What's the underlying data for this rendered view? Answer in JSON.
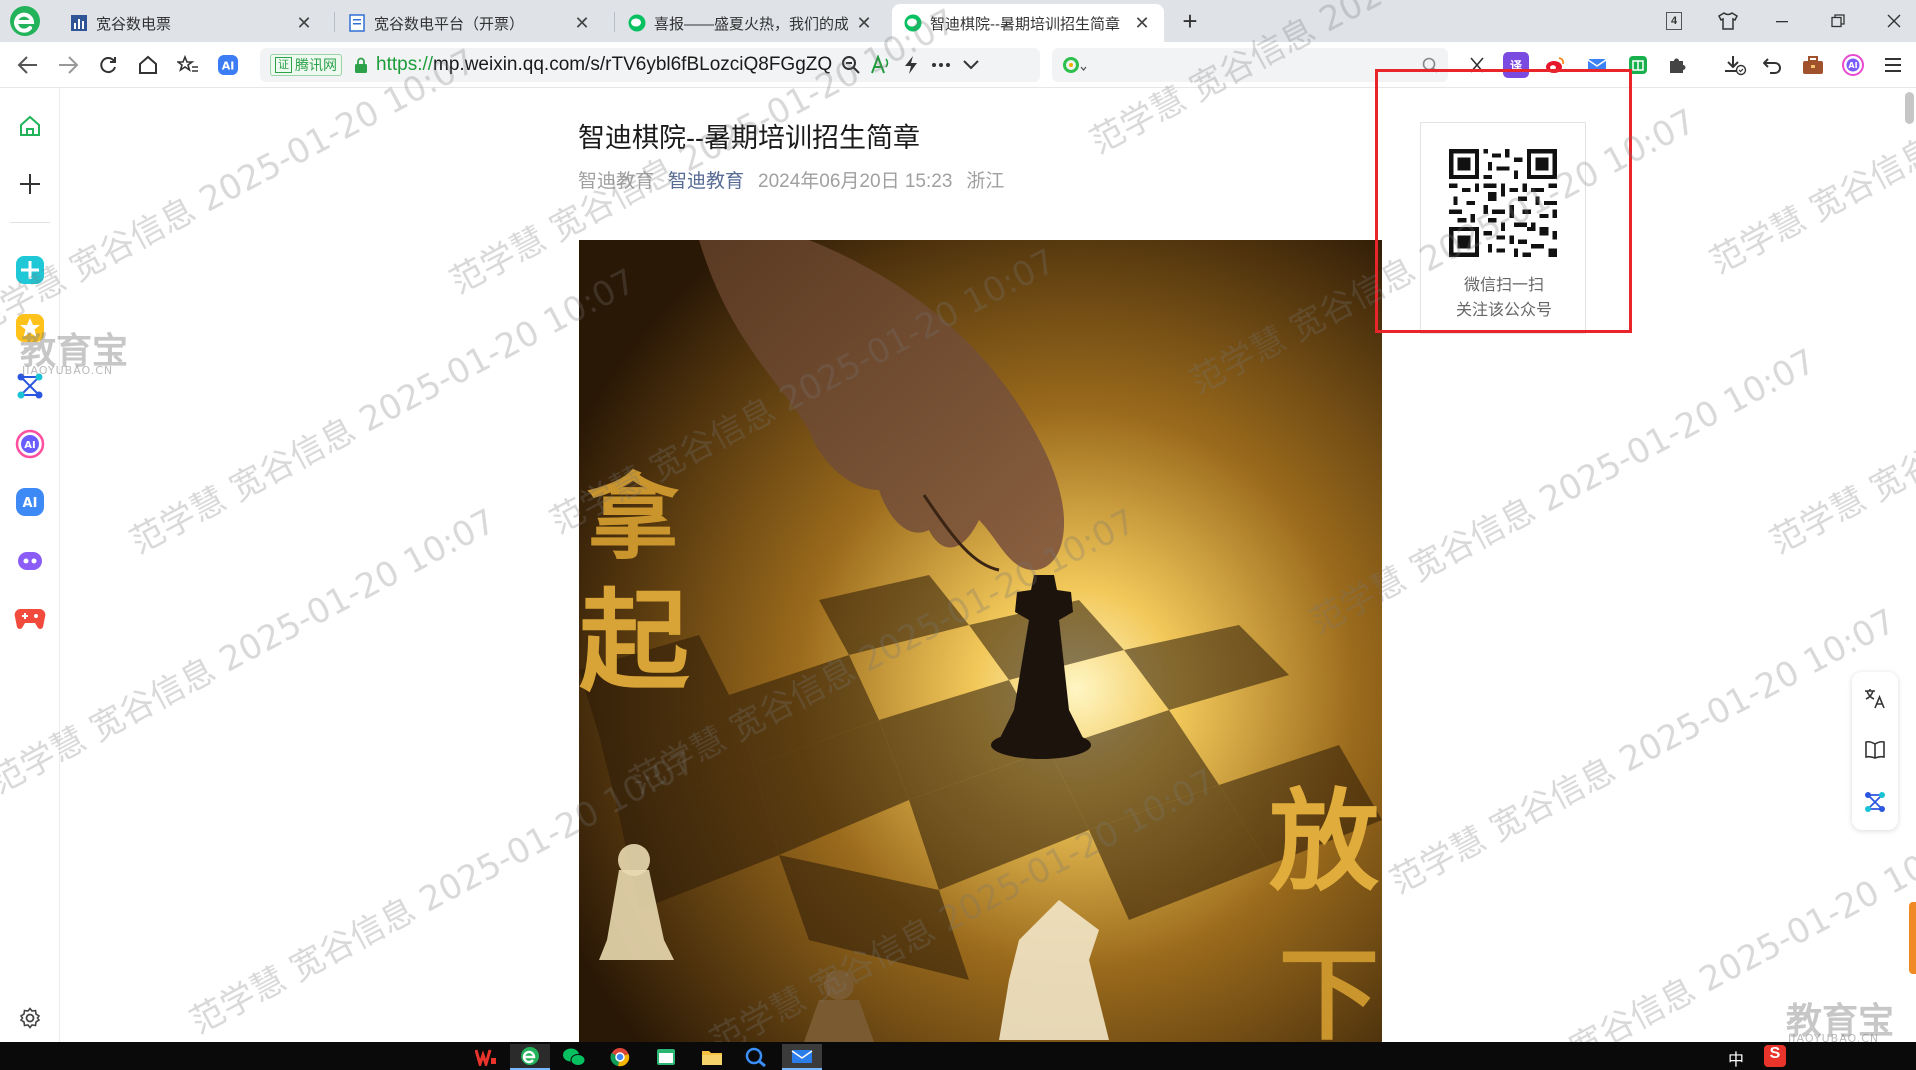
{
  "browser": {
    "tabs": [
      {
        "title": "宽谷数电票",
        "active": false
      },
      {
        "title": "宽谷数电平台（开票）",
        "active": false
      },
      {
        "title": "喜报——盛夏火热，我们的成",
        "active": false
      },
      {
        "title": "智迪棋院--暑期培训招生简章",
        "active": true
      }
    ],
    "tab_count": "4",
    "address": {
      "verified_badge": "证",
      "verified_label": "腾讯网",
      "url_scheme": "https://",
      "url_rest": "mp.weixin.qq.com/s/rTV6ybl6fBLozciQ8FGgZQ"
    },
    "search_placeholder": "",
    "ext_translate": "译"
  },
  "article": {
    "title": "智迪棋院--暑期培训招生简章",
    "author": "智迪教育",
    "account": "智迪教育",
    "date": "2024年06月20日 15:23",
    "location": "浙江",
    "hero_text_left_1": "拿",
    "hero_text_left_2": "起",
    "hero_text_right_1": "放",
    "hero_text_right_2": "下"
  },
  "qr_panel": {
    "line1": "微信扫一扫",
    "line2": "关注该公众号"
  },
  "watermark": {
    "text1": "范学慧  宽谷信息  2025-01-20 10:07",
    "brand": "教育宝",
    "brand_sub": "JIAOYUBAO.CN"
  },
  "taskbar": {
    "ime": "中",
    "ime_s": "S"
  },
  "colors": {
    "accent_green": "#1e9c3a",
    "account_link": "#576b95",
    "highlight_red": "#e8252a"
  }
}
